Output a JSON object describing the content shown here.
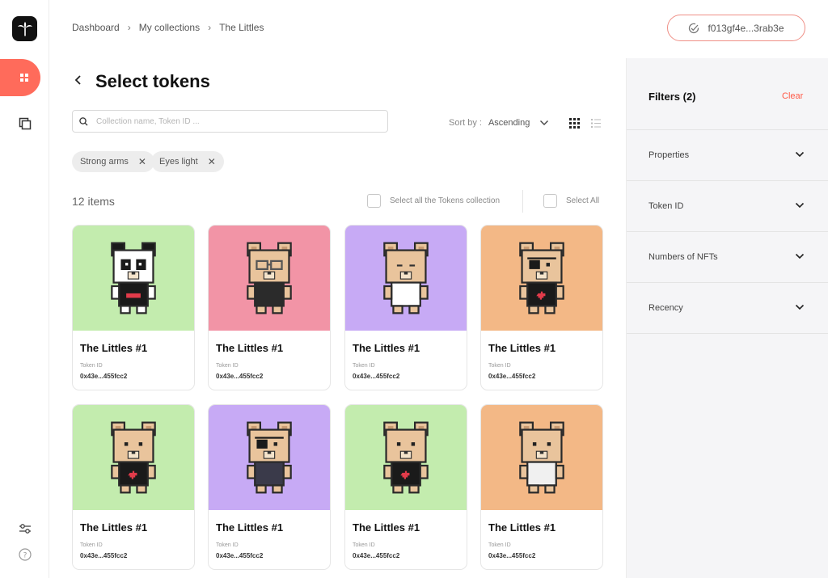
{
  "breadcrumb": [
    "Dashboard",
    "My collections",
    "The Littles"
  ],
  "wallet": {
    "address": "f013gf4e...3rab3e"
  },
  "page": {
    "title": "Select tokens"
  },
  "search": {
    "placeholder": "Collection name, Token ID ..."
  },
  "sort": {
    "label": "Sort by :",
    "value": "Ascending"
  },
  "chips": [
    "Strong arms",
    "Eyes light"
  ],
  "list": {
    "count": "12 items",
    "select_collection": "Select all the Tokens collection",
    "select_all": "Select All"
  },
  "cards": [
    {
      "name": "The Littles #1",
      "label": "Token ID",
      "token_id": "0x43e...455fcc2",
      "bg": "#c3ecae",
      "char": "panda",
      "fur": "#ffffff",
      "shirt": "#1a1a1a",
      "eye": "normal"
    },
    {
      "name": "The Littles #1",
      "label": "Token ID",
      "token_id": "0x43e...455fcc2",
      "bg": "#f294a6",
      "char": "bear",
      "fur": "#e9c49c",
      "shirt": "#2b2b2b",
      "eye": "glasses"
    },
    {
      "name": "The Littles #1",
      "label": "Token ID",
      "token_id": "0x43e...455fcc2",
      "bg": "#c7aaf5",
      "char": "bear",
      "fur": "#e9c49c",
      "shirt": "#ffffff",
      "eye": "closed"
    },
    {
      "name": "The Littles #1",
      "label": "Token ID",
      "token_id": "0x43e...455fcc2",
      "bg": "#f3b886",
      "char": "bear",
      "fur": "#e9c49c",
      "shirt": "#1a1a1a",
      "eye": "patch"
    },
    {
      "name": "The Littles #1",
      "label": "Token ID",
      "token_id": "0x43e...455fcc2",
      "bg": "#c3ecae",
      "char": "bear",
      "fur": "#e9c49c",
      "shirt": "#1a1a1a",
      "eye": "normal"
    },
    {
      "name": "The Littles #1",
      "label": "Token ID",
      "token_id": "0x43e...455fcc2",
      "bg": "#c7aaf5",
      "char": "bear",
      "fur": "#e9c49c",
      "shirt": "#3a3a4a",
      "eye": "patch"
    },
    {
      "name": "The Littles #1",
      "label": "Token ID",
      "token_id": "0x43e...455fcc2",
      "bg": "#c3ecae",
      "char": "bear",
      "fur": "#e9c49c",
      "shirt": "#1a1a1a",
      "eye": "normal"
    },
    {
      "name": "The Littles #1",
      "label": "Token ID",
      "token_id": "0x43e...455fcc2",
      "bg": "#f3b886",
      "char": "bear",
      "fur": "#e9c49c",
      "shirt": "#f0f0f0",
      "eye": "normal"
    }
  ],
  "filters": {
    "title": "Filters (2)",
    "clear": "Clear",
    "rows": [
      "Properties",
      "Token ID",
      "Numbers of NFTs",
      "Recency"
    ]
  },
  "colors": {
    "accent": "#ff6b5b",
    "clear": "#ff5a47"
  }
}
